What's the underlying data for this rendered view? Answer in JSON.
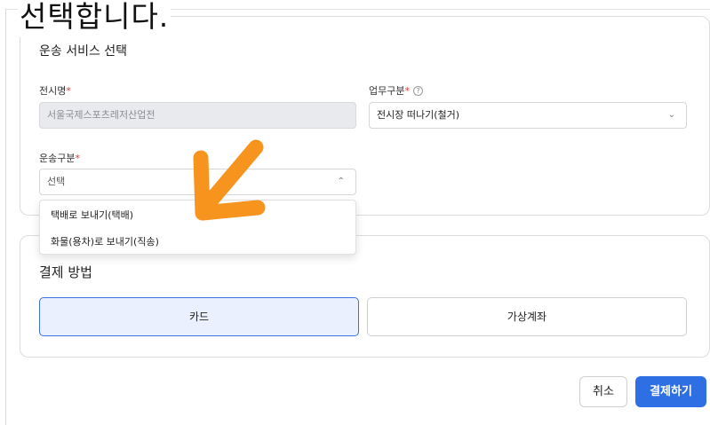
{
  "caption": "선택합니다.",
  "shipping": {
    "title": "운송 서비스 선택",
    "exhibition_label": "전시명",
    "exhibition_value": "서울국제스포츠레저산업전",
    "work_type_label": "업무구분",
    "work_type_value": "전시장 떠나기(철거)",
    "transport_label": "운송구분",
    "transport_placeholder": "선택",
    "required_mark": "*",
    "options": [
      "택배로 보내기(택배)",
      "화물(용차)로 보내기(직송)"
    ]
  },
  "payment": {
    "title": "결제 방법",
    "card_label": "카드",
    "virtual_account_label": "가상계좌"
  },
  "actions": {
    "cancel_label": "취소",
    "pay_label": "결제하기"
  },
  "colors": {
    "primary": "#2f6fe4",
    "required": "#e53935",
    "annotation_arrow": "#f7941d"
  }
}
